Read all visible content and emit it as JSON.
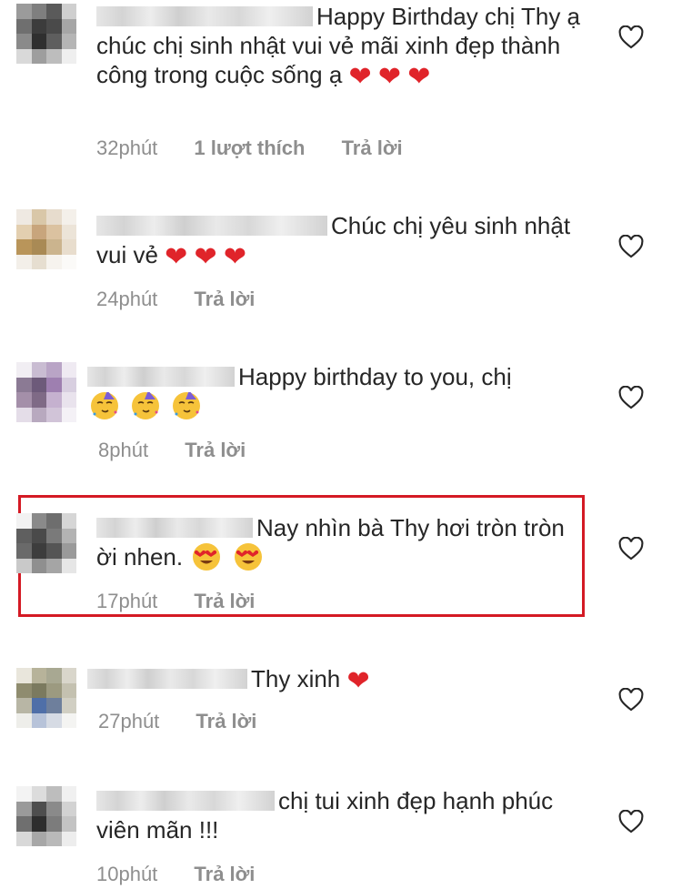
{
  "comments": [
    {
      "name_width": 238,
      "text": "Happy Birthday chị Thy ạ chúc chị sinh nhật vui vẻ mãi xinh đẹp thành công trong cuộc sống ạ",
      "emoji": "❤️ ❤️ ❤️",
      "time": "32phút",
      "likes": "1 lượt thích",
      "reply": "Trả lời",
      "avatar_colors": [
        "#9b9b9b",
        "#7f7f7f",
        "#5a5a5a",
        "#cfcfcf",
        "#6f6f6f",
        "#3c3c3c",
        "#4a4a4a",
        "#a6a6a6",
        "#8a8a8a",
        "#2f2f2f",
        "#5e5e5e",
        "#b5b5b5",
        "#d9d9d9",
        "#9e9e9e",
        "#bdbdbd",
        "#efefef"
      ]
    },
    {
      "name_width": 256,
      "text": "Chúc chị yêu sinh nhật vui vẻ",
      "emoji": "❤️ ❤️ ❤️",
      "time": "24phút",
      "reply": "Trả lời",
      "avatar_colors": [
        "#efe9e2",
        "#d9c7a8",
        "#e7dccd",
        "#f4f0ea",
        "#e3cfb0",
        "#c8a57c",
        "#dbc2a0",
        "#ece4d8",
        "#b9955a",
        "#a98a55",
        "#cbb48e",
        "#e8ddcd",
        "#f3efe9",
        "#e6ded0",
        "#f6f3ee",
        "#fbfaf8"
      ]
    },
    {
      "name_width": 162,
      "text": "Happy birthday to you, chị",
      "emoji": "🥳 🥳 🥳",
      "time": "8phút",
      "reply": "Trả lời",
      "avatar_colors": [
        "#f1eef3",
        "#c9bcd2",
        "#b9a4c6",
        "#efeaf2",
        "#8b7a94",
        "#6d5a7a",
        "#9e7fb0",
        "#d8cfe0",
        "#a48fa9",
        "#7f6a86",
        "#c5b1cf",
        "#e9e3ed",
        "#e4dde8",
        "#b8a9bf",
        "#d1c4d8",
        "#f4f1f6"
      ]
    },
    {
      "name_width": 176,
      "text": "Nay nhìn bà Thy hơi tròn tròn ời nhen.",
      "emoji": "😍 😍",
      "time": "17phút",
      "reply": "Trả lời",
      "avatar_colors": [
        "#f2f2f2",
        "#8a8a8a",
        "#6e6e6e",
        "#d6d6d6",
        "#5f5f5f",
        "#4a4a4a",
        "#7a7a7a",
        "#b3b3b3",
        "#6a6a6a",
        "#3d3d3d",
        "#555555",
        "#9a9a9a",
        "#c9c9c9",
        "#8f8f8f",
        "#a5a5a5",
        "#e6e6e6"
      ]
    },
    {
      "name_width": 176,
      "text": "Thy xinh",
      "emoji": "❤️",
      "time": "27phút",
      "reply": "Trả lời",
      "avatar_colors": [
        "#e9e6dc",
        "#b7b39a",
        "#a8a892",
        "#d9d6cb",
        "#8f8c6f",
        "#7b7a5f",
        "#9c9a80",
        "#c4c1b0",
        "#b8b6a5",
        "#4f6fa8",
        "#6e7f9c",
        "#d1cfc3",
        "#eeeeea",
        "#b7c3d9",
        "#d6dbe4",
        "#f4f4f2"
      ]
    },
    {
      "name_width": 198,
      "text": "chị tui xinh đẹp hạnh phúc viên mãn !!!",
      "emoji": "",
      "time": "10phút",
      "reply": "Trả lời",
      "avatar_colors": [
        "#f3f3f3",
        "#dcdcdc",
        "#bdbdbd",
        "#f0f0f0",
        "#9a9a9a",
        "#4e4e4e",
        "#8a8a8a",
        "#d2d2d2",
        "#6f6f6f",
        "#2e2e2e",
        "#7c7c7c",
        "#c3c3c3",
        "#d8d8d8",
        "#a7a7a7",
        "#b9b9b9",
        "#ededed"
      ]
    }
  ]
}
